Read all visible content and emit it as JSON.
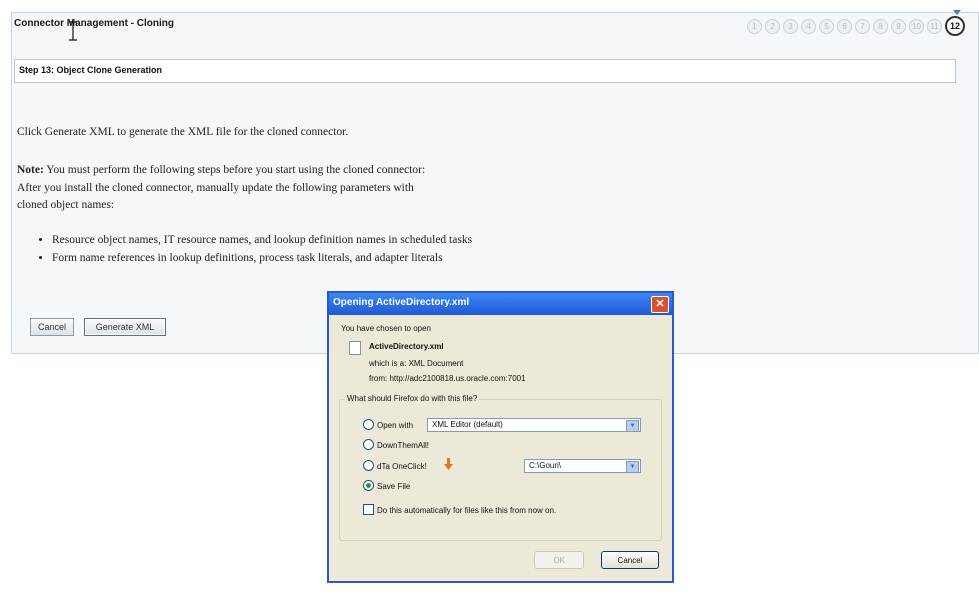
{
  "page": {
    "title": "Connector Management - Cloning",
    "steps": [
      "1",
      "2",
      "3",
      "4",
      "5",
      "6",
      "7",
      "8",
      "9",
      "10",
      "11",
      "12"
    ],
    "current_step": "12",
    "step_header": "Step 13: Object Clone Generation",
    "intro": "Click Generate XML to generate the XML file for the cloned connector.",
    "note_label": "Note:",
    "note_text": " You must perform the following steps before you start using the cloned connector:",
    "after_install_line1": "After you install the cloned connector, manually update the following parameters with",
    "after_install_line2": "cloned object names:",
    "bullets": [
      "Resource object names, IT resource names, and lookup definition names in scheduled tasks",
      "Form name references in lookup definitions, process task literals, and adapter literals"
    ],
    "cancel_label": "Cancel",
    "generate_label": "Generate XML"
  },
  "dialog": {
    "title": "Opening ActiveDirectory.xml",
    "chosen_text": "You have chosen to open",
    "filename": "ActiveDirectory.xml",
    "which_is": "which is a:  XML Document",
    "from": "from:  http://adc2100818.us.oracle.com:7001",
    "question": "What should Firefox do with this file?",
    "option_open_with": "Open with",
    "open_with_value": "XML Editor (default)",
    "option_downthemall": "DownThemAll!",
    "option_dta": "dTa OneClick!",
    "dta_path": "C:\\Gouri\\",
    "option_save": "Save File",
    "auto_checkbox": "Do this automatically for files like this from now on.",
    "ok_label": "OK",
    "cancel_label": "Cancel"
  }
}
